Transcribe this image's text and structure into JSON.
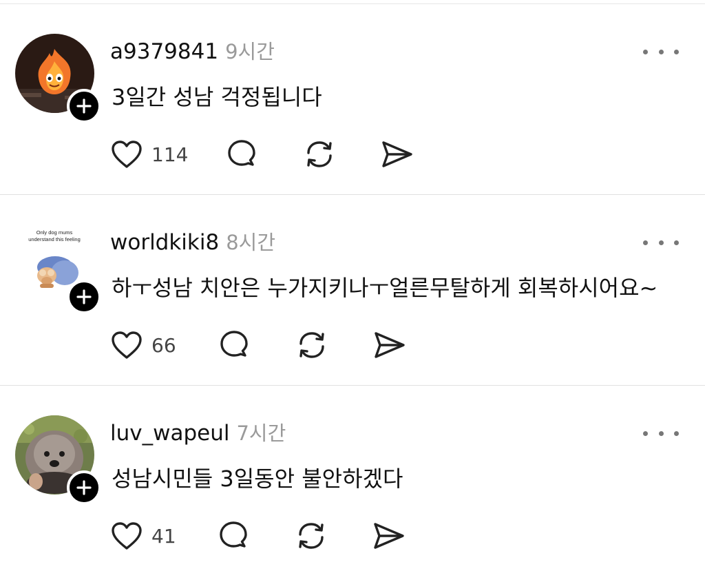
{
  "posts": [
    {
      "username": "a9379841",
      "time": "9시간",
      "text": "3일간 성남 걱정됩니다",
      "likes": "114",
      "avatar": "fire-sprite-avatar"
    },
    {
      "username": "worldkiki8",
      "time": "8시간",
      "text": "하ㅜ성남 치안은 누가지키나ㅜ얼른무탈하게 회복하시어요~",
      "likes": "66",
      "avatar": "dog-mums-meme-avatar",
      "avatar_caption": [
        "Only dog mums",
        "understand this feeling"
      ]
    },
    {
      "username": "luv_wapeul",
      "time": "7시간",
      "text": "성남시민들 3일동안 불안하겠다",
      "likes": "41",
      "avatar": "poodle-avatar"
    }
  ],
  "icons": {
    "like": "heart-icon",
    "reply": "comment-icon",
    "repost": "repost-icon",
    "share": "send-icon",
    "more": "more-icon",
    "follow": "plus-icon"
  },
  "colors": {
    "text": "#111111",
    "muted": "#9a9a9a",
    "badge": "#000000",
    "divider": "#e0e0e0"
  }
}
